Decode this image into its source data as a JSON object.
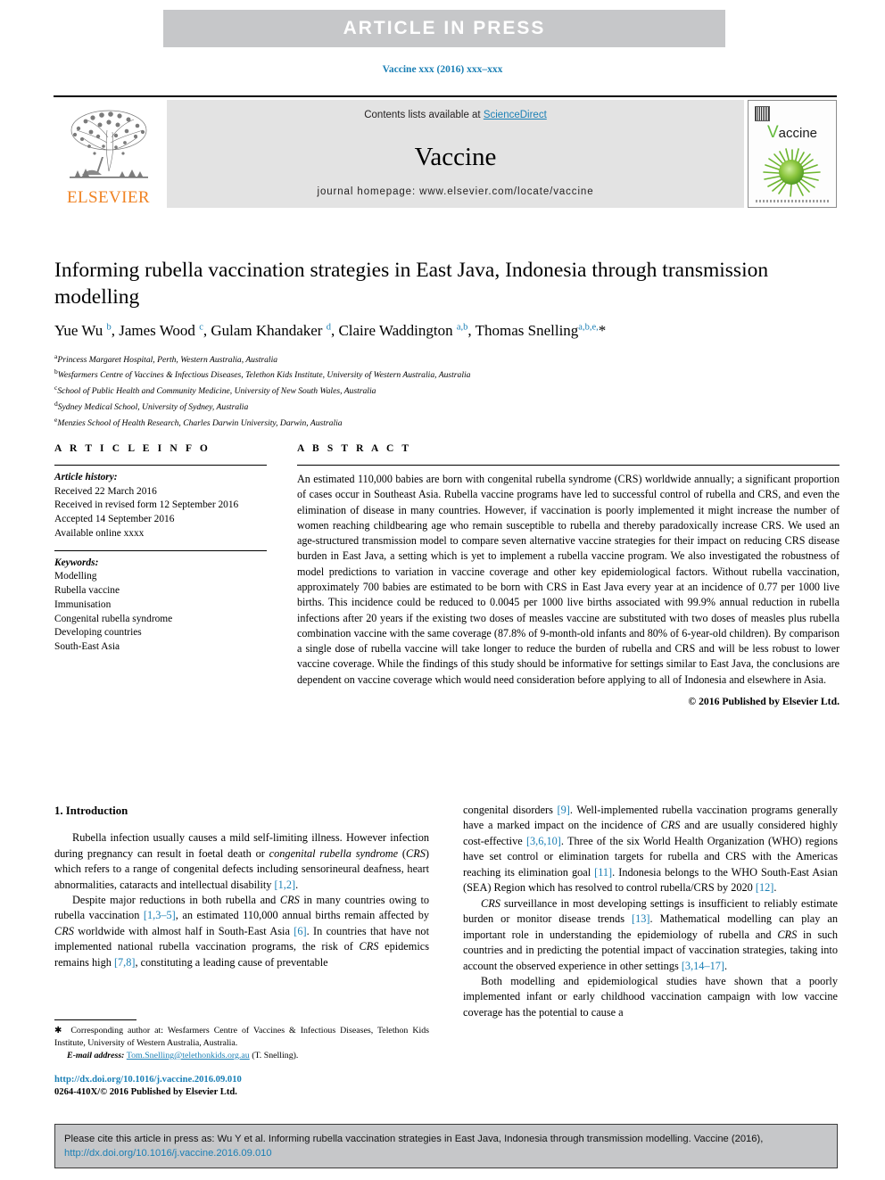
{
  "banner": {
    "text": "ARTICLE  IN  PRESS"
  },
  "journal_ref": "Vaccine xxx (2016) xxx–xxx",
  "masthead": {
    "contents_prefix": "Contents lists available at ",
    "sciencedirect": "ScienceDirect",
    "journal_name": "Vaccine",
    "homepage": "journal homepage: www.elsevier.com/locate/vaccine",
    "publisher": "ELSEVIER",
    "cover_title_initial": "V",
    "cover_title_rest": "accine",
    "accent_blue": "#1a7fb5",
    "elsevier_orange": "#f08323",
    "banner_grey": "#c6c7c9"
  },
  "article": {
    "title": "Informing rubella vaccination strategies in East Java, Indonesia through transmission modelling",
    "authors_html": "Yue Wu <sup>b</sup>, James Wood <sup>c</sup>, Gulam Khandaker <sup>d</sup>, Claire Waddington <sup>a,b</sup>, Thomas Snelling<sup>a,b,e,</sup>*",
    "affiliations": [
      {
        "marker": "a",
        "text": "Princess Margaret Hospital, Perth, Western Australia, Australia"
      },
      {
        "marker": "b",
        "text": "Wesfarmers Centre of Vaccines & Infectious Diseases, Telethon Kids Institute, University of Western Australia, Australia"
      },
      {
        "marker": "c",
        "text": "School of Public Health and Community Medicine, University of New South Wales, Australia"
      },
      {
        "marker": "d",
        "text": "Sydney Medical School, University of Sydney, Australia"
      },
      {
        "marker": "e",
        "text": "Menzies School of Health Research, Charles Darwin University, Darwin, Australia"
      }
    ]
  },
  "article_info": {
    "heading": "A R T I C L E   I N F O",
    "history_label": "Article history:",
    "history": [
      "Received 22 March 2016",
      "Received in revised form 12 September 2016",
      "Accepted 14 September 2016",
      "Available online xxxx"
    ],
    "keywords_label": "Keywords:",
    "keywords": [
      "Modelling",
      "Rubella vaccine",
      "Immunisation",
      "Congenital rubella syndrome",
      "Developing countries",
      "South-East Asia"
    ]
  },
  "abstract": {
    "heading": "A B S T R A C T",
    "text": "An estimated 110,000 babies are born with congenital rubella syndrome (CRS) worldwide annually; a significant proportion of cases occur in Southeast Asia. Rubella vaccine programs have led to successful control of rubella and CRS, and even the elimination of disease in many countries. However, if vaccination is poorly implemented it might increase the number of women reaching childbearing age who remain susceptible to rubella and thereby paradoxically increase CRS. We used an age-structured transmission model to compare seven alternative vaccine strategies for their impact on reducing CRS disease burden in East Java, a setting which is yet to implement a rubella vaccine program. We also investigated the robustness of model predictions to variation in vaccine coverage and other key epidemiological factors. Without rubella vaccination, approximately 700 babies are estimated to be born with CRS in East Java every year at an incidence of 0.77 per 1000 live births. This incidence could be reduced to 0.0045 per 1000 live births associated with 99.9% annual reduction in rubella infections after 20 years if the existing two doses of measles vaccine are substituted with two doses of measles plus rubella combination vaccine with the same coverage (87.8% of 9-month-old infants and 80% of 6-year-old children). By comparison a single dose of rubella vaccine will take longer to reduce the burden of rubella and CRS and will be less robust to lower vaccine coverage. While the findings of this study should be informative for settings similar to East Java, the conclusions are dependent on vaccine coverage which would need consideration before applying to all of Indonesia and elsewhere in Asia.",
    "copyright": "© 2016 Published by Elsevier Ltd."
  },
  "introduction": {
    "section_title": "1. Introduction",
    "left_para_1_html": "Rubella infection usually causes a mild self-limiting illness. However infection during pregnancy can result in foetal death or <span class=\"ital\">congenital rubella syndrome</span> (<span class=\"ital\">CRS</span>) which refers to a range of congenital defects including sensorineural deafness, heart abnormalities, cataracts and intellectual disability <span class=\"ref\">[1,2]</span>.",
    "left_para_2_html": "Despite major reductions in both rubella and <span class=\"ital\">CRS</span> in many countries owing to rubella vaccination <span class=\"ref\">[1,3–5]</span>, an estimated 110,000 annual births remain affected by <span class=\"ital\">CRS</span> worldwide with almost half in South-East Asia <span class=\"ref\">[6]</span>. In countries that have not implemented national rubella vaccination programs, the risk of <span class=\"ital\">CRS</span> epidemics remains high <span class=\"ref\">[7,8]</span>, constituting a leading cause of preventable",
    "right_para_1_html": "congenital disorders <span class=\"ref\">[9]</span>. Well-implemented rubella vaccination programs generally have a marked impact on the incidence of <span class=\"ital\">CRS</span> and are usually considered highly cost-effective <span class=\"ref\">[3,6,10]</span>. Three of the six World Health Organization (WHO) regions have set control or elimination targets for rubella and CRS with the Americas reaching its elimination goal <span class=\"ref\">[11]</span>. Indonesia belongs to the WHO South-East Asian (SEA) Region which has resolved to control rubella/CRS by 2020 <span class=\"ref\">[12]</span>.",
    "right_para_2_html": "<span class=\"ital\">CRS</span> surveillance in most developing settings is insufficient to reliably estimate burden or monitor disease trends <span class=\"ref\">[13]</span>. Mathematical modelling can play an important role in understanding the epidemiology of rubella and <span class=\"ital\">CRS</span> in such countries and in predicting the potential impact of vaccination strategies, taking into account the observed experience in other settings <span class=\"ref\">[3,14–17]</span>.",
    "right_para_3_html": "Both modelling and epidemiological studies have shown that a poorly implemented infant or early childhood vaccination campaign with low vaccine coverage has the potential to cause a"
  },
  "footnote": {
    "line1_html": "<span class=\"star\">&#10033;</span>&nbsp; Corresponding author at: Wesfarmers Centre of Vaccines &amp; Infectious Diseases, Telethon Kids Institute, University of Western Australia, Australia.",
    "email_label": "E-mail address:",
    "email": "Tom.Snelling@telethonkids.org.au",
    "email_suffix": " (T. Snelling)."
  },
  "doi": {
    "url": "http://dx.doi.org/10.1016/j.vaccine.2016.09.010",
    "issn_line": "0264-410X/© 2016 Published by Elsevier Ltd."
  },
  "cite_box": {
    "text_before": "Please cite this article in press as: Wu Y et al. Informing rubella vaccination strategies in East Java, Indonesia through transmission modelling. Vaccine (2016), ",
    "link": "http://dx.doi.org/10.1016/j.vaccine.2016.09.010"
  }
}
